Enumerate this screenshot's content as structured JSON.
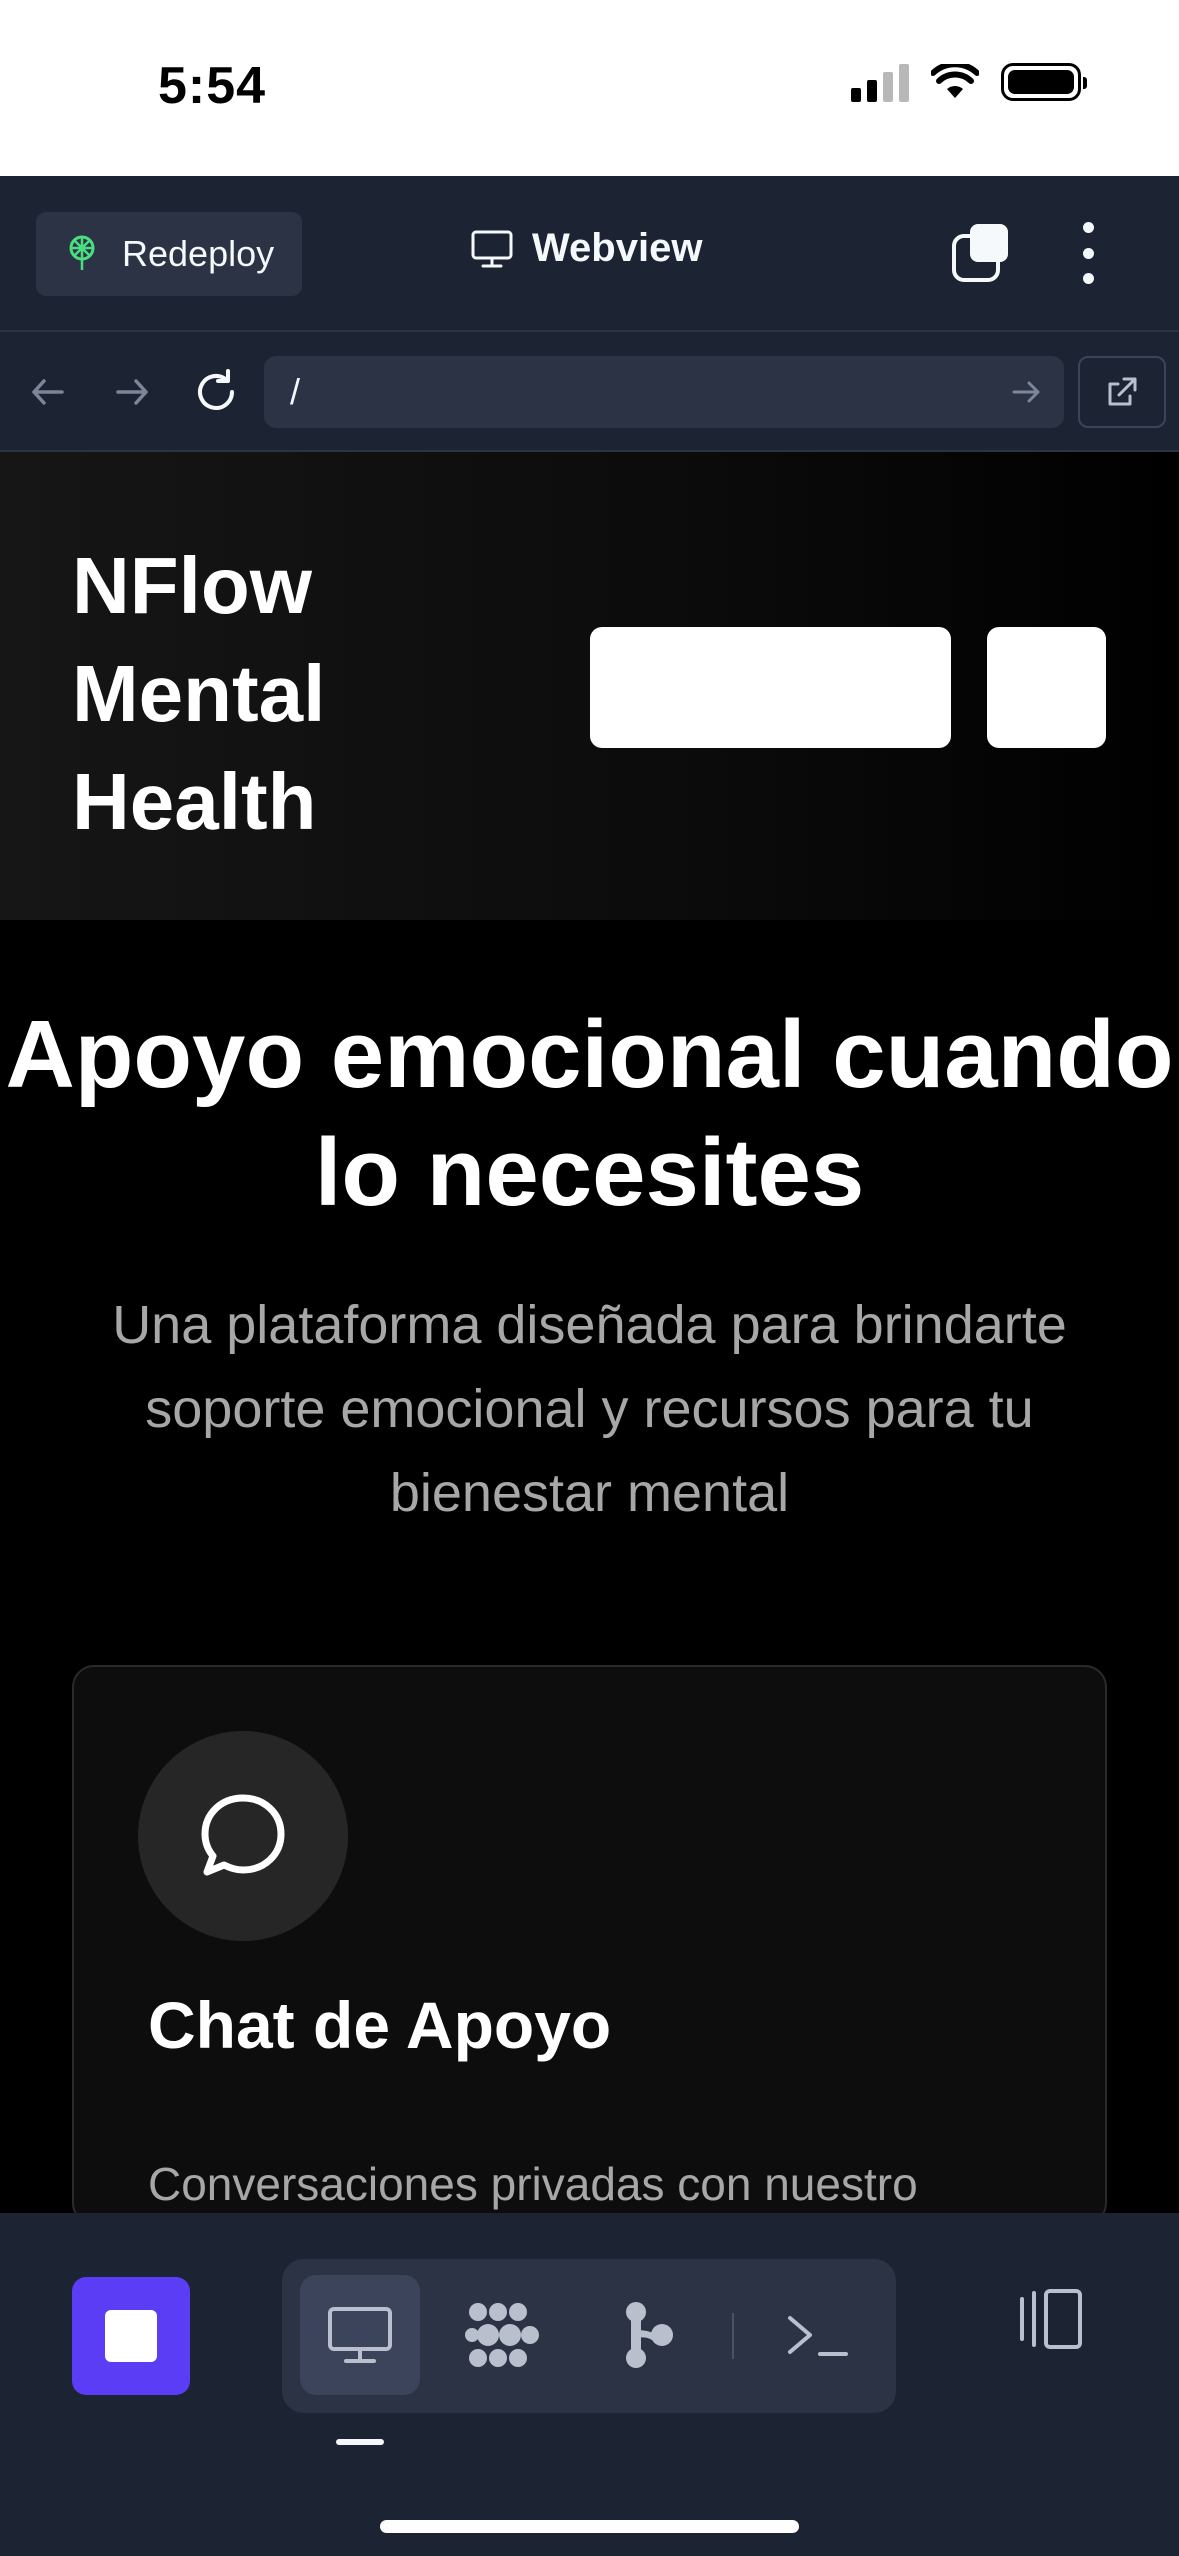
{
  "status_bar": {
    "time": "5:54"
  },
  "app_bar": {
    "redeploy_label": "Redeploy",
    "title": "Webview"
  },
  "url_bar": {
    "value": "/"
  },
  "site": {
    "logo": "NFlow Mental Health",
    "hero_title": "Apoyo emocional cuando lo necesites",
    "hero_subtitle": "Una plataforma diseñada para brindarte soporte emocional y recursos para tu bienestar mental",
    "card": {
      "title": "Chat de Apoyo",
      "description": "Conversaciones privadas con nuestro"
    }
  },
  "icons": {
    "redeploy": "deploy-icon",
    "webview": "monitor-icon",
    "tabs": "tabs-icon",
    "menu": "kebab-icon",
    "back": "arrow-left-icon",
    "forward": "arrow-right-icon",
    "reload": "reload-icon",
    "go": "arrow-right-icon",
    "external": "external-link-icon",
    "card": "chat-bubble-icon",
    "stop": "stop-icon",
    "tools": [
      "monitor-icon",
      "packages-icon",
      "git-icon",
      "terminal-icon"
    ],
    "panel": "split-panel-icon"
  },
  "colors": {
    "app_bar_bg": "#1c2333",
    "surface": "#2b3345",
    "accent": "#5b3df5",
    "deploy_green": "#4ade80",
    "page_bg": "#000000"
  }
}
